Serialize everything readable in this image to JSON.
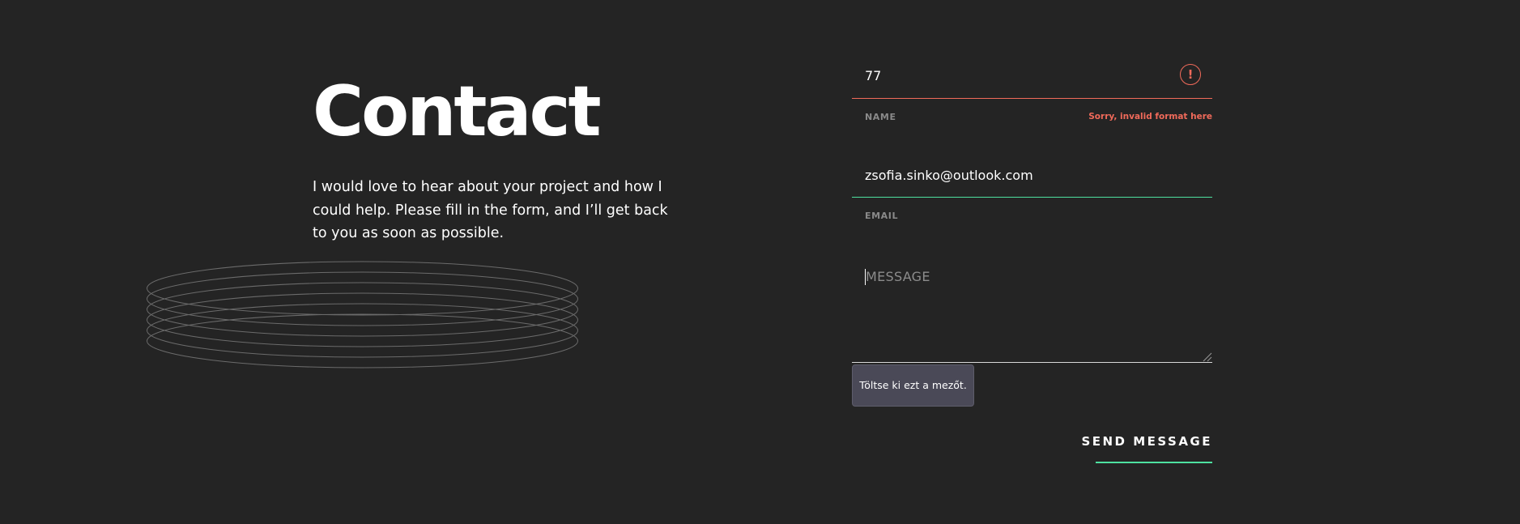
{
  "contact": {
    "title": "Contact",
    "intro": "I would love to hear about your project and how I could help. Please fill in the form, and I’ll get back to you as soon as possible."
  },
  "form": {
    "name": {
      "value": "77",
      "label": "NAME",
      "error": "Sorry, invalid format here",
      "error_icon": "!",
      "line_color": "#f06a5a"
    },
    "email": {
      "value": "zsofia.sinko@outlook.com",
      "label": "EMAIL",
      "line_color": "#4ee1a0"
    },
    "message": {
      "placeholder": "MESSAGE",
      "value": ""
    },
    "validation_tooltip": "Töltse ki ezt a mezőt.",
    "send_label": "SEND MESSAGE"
  },
  "colors": {
    "background": "#242424",
    "accent": "#4ee1a0",
    "error": "#f06a5a"
  }
}
